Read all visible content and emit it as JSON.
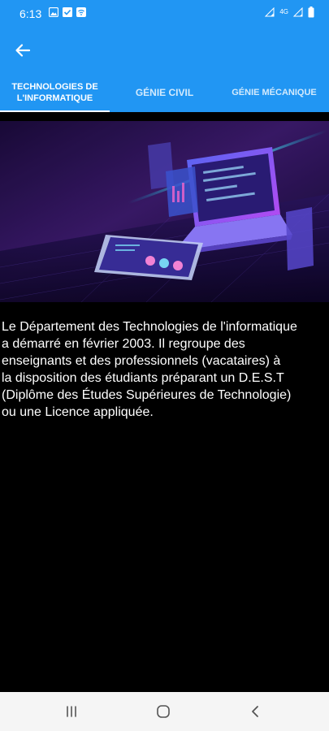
{
  "status_bar": {
    "time": "6:13",
    "icons": [
      "image-icon",
      "checkbox-icon",
      "wifi-calling-icon",
      "signal-icon",
      "4g-icon",
      "battery-icon"
    ],
    "network": "4G"
  },
  "app_bar": {
    "back_icon": "arrow-left-icon"
  },
  "tabs": [
    {
      "label": "TECHNOLOGIES DE L'INFORMATIQUE",
      "line1": "TECHNOLOGIES DE",
      "line2": "L'INFORMATIQUE",
      "selected": true
    },
    {
      "label": "GÉNIE CIVIL",
      "selected": false
    },
    {
      "label": "GÉNIE MÉCANIQUE",
      "selected": false
    }
  ],
  "description": "Le Département des Technologies de l'informatique\na démarré en février 2003. Il regroupe des\nenseignants et des professionnels (vacataires) à\nla disposition des étudiants préparant un D.E.S.T\n(Diplôme des Études Supérieures de Technologie)\nou une Licence appliquée.",
  "nav_bar": {
    "recents_icon": "recents-icon",
    "home_icon": "home-icon",
    "back_icon": "back-chevron-icon"
  },
  "colors": {
    "primary": "#2196f3",
    "background": "#000000",
    "text": "#ffffff"
  }
}
